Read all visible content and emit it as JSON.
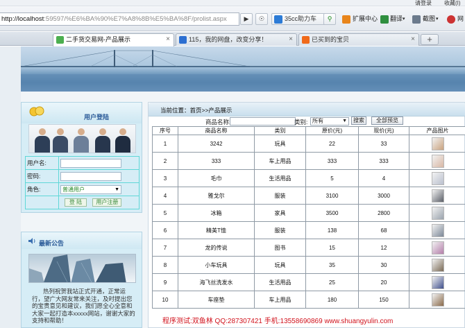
{
  "browser": {
    "top_links": [
      "请登录",
      "收藏(I)"
    ],
    "url_host": "http://localhost",
    "url_rest": ":59597/%E6%BA%90%E7%A8%8B%E5%BA%8F/prolist.aspx",
    "button_35cc": "35cc助力车",
    "ext_center": "扩展中心",
    "translate": "翻译",
    "screenshot": "截图",
    "tabs": [
      {
        "label": "二手货交易网-产品展示",
        "active": true
      },
      {
        "label": "115，我的网盘，改变分享！",
        "active": false
      },
      {
        "label": "已买到的宝贝",
        "active": false
      }
    ],
    "new_tab": "+"
  },
  "login": {
    "title": "用户登陆",
    "username_label": "用户名:",
    "password_label": "密码:",
    "role_label": "角色:",
    "role_value": "普通用户",
    "login_button": "登 陆",
    "register_button": "用户注册"
  },
  "notice": {
    "title": "最新公告",
    "text": "热列祝贺我站正式开通，正常运行，望广大网友常来关注，及时提出您的宝贵意见和建议，我们愿全心全意和大家一起打造本xxxxx网站，谢谢大家的支持和帮助！"
  },
  "main": {
    "breadcrumb": "当前位置：首页>>产品展示",
    "search_name_label": "商品名称:",
    "search_type_label": "类别:",
    "search_type_value": "所有",
    "search_button": "搜索",
    "all_button": "全部预览",
    "columns": [
      "序号",
      "商品名称",
      "类别",
      "原价(元)",
      "现价(元)",
      "产品图片"
    ],
    "rows": [
      {
        "no": "1",
        "name": "3242",
        "category": "玩具",
        "orig": "22",
        "now": "33",
        "img": "#c9a27e"
      },
      {
        "no": "2",
        "name": "333",
        "category": "车上用品",
        "orig": "333",
        "now": "333",
        "img": "#d8b7a4"
      },
      {
        "no": "3",
        "name": "毛巾",
        "category": "生活用品",
        "orig": "5",
        "now": "4",
        "img": "#b9bfcd"
      },
      {
        "no": "4",
        "name": "雅戈尔",
        "category": "服装",
        "orig": "3100",
        "now": "3000",
        "img": "#5b5f68"
      },
      {
        "no": "5",
        "name": "冰箱",
        "category": "家具",
        "orig": "3500",
        "now": "2800",
        "img": "#9aa3ad"
      },
      {
        "no": "6",
        "name": "精美T恤",
        "category": "服装",
        "orig": "138",
        "now": "68",
        "img": "#7b8797"
      },
      {
        "no": "7",
        "name": "龙的传说",
        "category": "图书",
        "orig": "15",
        "now": "12",
        "img": "#b47eaa"
      },
      {
        "no": "8",
        "name": "小车玩具",
        "category": "玩具",
        "orig": "35",
        "now": "30",
        "img": "#7a6a55"
      },
      {
        "no": "9",
        "name": "海飞丝洗发水",
        "category": "生活用品",
        "orig": "25",
        "now": "20",
        "img": "#3f4f8c"
      },
      {
        "no": "10",
        "name": "车座垫",
        "category": "车上用品",
        "orig": "180",
        "now": "150",
        "img": "#8a6a4a"
      }
    ],
    "footer": "程序测试:双鱼林 QQ:287307421 手机:13558690869 www.shuangyulin.com"
  },
  "colors": {
    "accent": "#2a5a98",
    "footer_red": "#d1121c",
    "grid_cyan": "#5fd7d7"
  }
}
